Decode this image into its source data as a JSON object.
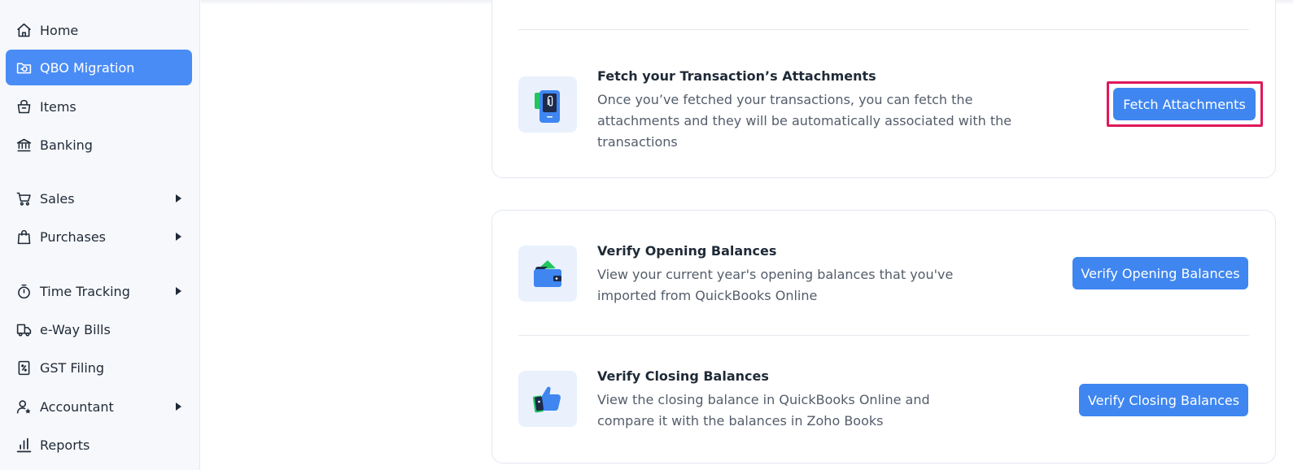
{
  "sidebar": {
    "items": [
      {
        "label": "Home",
        "icon": "home-icon",
        "active": false,
        "caret": false
      },
      {
        "label": "QBO Migration",
        "icon": "migration-icon",
        "active": true,
        "caret": false
      },
      {
        "label": "Items",
        "icon": "items-basket-icon",
        "active": false,
        "caret": false
      },
      {
        "label": "Banking",
        "icon": "bank-icon",
        "active": false,
        "caret": false
      },
      {
        "label": "Sales",
        "icon": "cart-icon",
        "active": false,
        "caret": true
      },
      {
        "label": "Purchases",
        "icon": "shopping-bag-icon",
        "active": false,
        "caret": true
      },
      {
        "label": "Time Tracking",
        "icon": "stopwatch-icon",
        "active": false,
        "caret": true
      },
      {
        "label": "e-Way Bills",
        "icon": "truck-icon",
        "active": false,
        "caret": false
      },
      {
        "label": "GST Filing",
        "icon": "tax-document-icon",
        "active": false,
        "caret": false
      },
      {
        "label": "Accountant",
        "icon": "accountant-icon",
        "active": false,
        "caret": true
      },
      {
        "label": "Reports",
        "icon": "bar-chart-icon",
        "active": false,
        "caret": false
      }
    ]
  },
  "main": {
    "fetch_attachments": {
      "title": "Fetch your Transaction’s Attachments",
      "desc_line1": "Once you’ve fetched your transactions, you can fetch the",
      "desc_line2": "attachments and they will be automatically associated with the",
      "desc_line3": "transactions",
      "button": "Fetch Attachments",
      "icon": "attachment-phone-icon"
    },
    "verify_opening": {
      "title": "Verify Opening Balances",
      "desc_line1": "View your current year's opening balances that you've",
      "desc_line2": "imported from QuickBooks Online",
      "button": "Verify Opening Balances",
      "icon": "wallet-icon"
    },
    "verify_closing": {
      "title": "Verify Closing Balances",
      "desc_line1": "View the closing balance in QuickBooks Online and",
      "desc_line2": "compare it with the balances in Zoho Books",
      "button": "Verify Closing Balances",
      "icon": "thumbs-up-icon"
    }
  },
  "colors": {
    "accent": "#3f86f0",
    "active_nav": "#4a8cf5",
    "highlight_border": "#e0185a"
  }
}
